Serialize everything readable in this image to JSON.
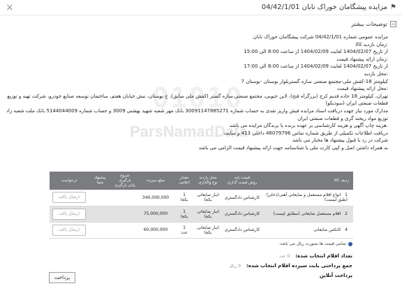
{
  "header": {
    "title": "مزایده پیشگامان خوراک تابان 04/42/1/01"
  },
  "section": {
    "title": "توضیحات بیشتر"
  },
  "description": [
    "مزایده عمومی شماره 04/42/1/01 شرکت پیشگامان خوراک تابان",
    ":زمان بازدید کالا",
    "از تاریخ 1404/02/07 لغایت 1404/02/09 از ساعت 8:00 الی 15:00",
    ":زمان ارائه پیشنهاد قیمت",
    "از تاریخ 1404/02/07 لغایت 1404/02/09 از ساعت 8:00 الی 17:00",
    ":محل بازدید",
    "کیلومتر 18-کفش ملی-مجتمع صنعتی سازه گستربلوار بوستان -بوستان 7",
    ":محل ارائه پیشنهاد قیمت",
    "تهران، کیلومتر 18 جاده قدیم کرج (بزرگراه فتح)، لاین جنوبی، مجتمع صنعتی سازه گستر (کفش ملی سابق)، خ بوستان، نبش خیابان هفتم، ساختمان توسعه صنایع خودرو، شرکت تهیه و توزیع مواد ریخته گری و",
    "قطعات صنعتی ایران (سودیکو)",
    "مدارک مورد نیاز جهت دریافت اسناد مزایده فیش واریز نقدی به حساب شماره 30091147885271 بانک مهر شعبه شهید بهشتی 3009 و حساب شماره 5144044009 بانک ملت شعبه زامیاد به نام شرکت تهیه و",
    "توزیع مواد ریخته گری و قطعات صنعتی ایران",
    ".هزینه چاپ آگهی و هزینه کارشناسی بر عهده برنده یا برندگان مزایده می باشد",
    "دریافت اطلاعات تکمیلی از طریق شماره تماس 46079796 داخلی 413 و سایت",
    "شرکت در رد یا قبول پیشنهاد ها مختار می باشد",
    "به همراه داشتن اصل و کپی کارت ملی یا شناسنامه جهت ارائه پیشنهاد قیمت الزامی می باشد"
  ],
  "watermark": {
    "number": "01010",
    "name": "ParsNamadData"
  },
  "table": {
    "headers": {
      "row": "ردیف کالا",
      "base_price": "قیمت پایه",
      "pricing_method": "روش قیمت گذاری",
      "location": "محل بازدید",
      "delivery": "نوع واگذاری",
      "quantity": "مقدار اعلامی",
      "amount": "مبلغ سپرده",
      "start_time": "شروع بارگیری",
      "end_time": "پایان بارگیری",
      "user_offer": "پیشنهاد شما",
      "request": "درخواست"
    },
    "rows": [
      {
        "num": "1",
        "name": "انواع اقلام مستعمل و ضایعاتی آهنی(ذخایر)(طبق لیست)",
        "method": "کارشناس دادگستری",
        "location": "انبار ضایعاتی",
        "delivery": "یکجا",
        "qty": "1",
        "qty_unit": "یکجا",
        "amount": "340,000,000",
        "request_label": "ارسال پاکت"
      },
      {
        "num": "2",
        "name": "اقلام مستعمل ضایعاتی (مطابق لیست)",
        "method": "کارشناس دادگستری",
        "location": "انبار ضایعاتی",
        "delivery": "یکجا",
        "qty": "1",
        "qty_unit": "یکجا",
        "amount": "75,000,000",
        "request_label": "ارسال پاکت"
      },
      {
        "num": "4",
        "name": "کانکس ضایعاتی",
        "method": "کارشناس دادگستری",
        "location": "انبار ضایعاتی",
        "delivery": "یکجا",
        "qty": "1",
        "qty_unit": "عدد",
        "amount": "60,000,000",
        "request_label": "ارسال پاکت"
      }
    ]
  },
  "note": "تمامی قیمت ها بصورت ریال می باشد.",
  "summary": {
    "selected_count_label": "تعداد اقلام انتخاب شده:",
    "selected_count_value": "0 عدد",
    "deposit_total_label": "جمع پرداختی بابت سپرده اقلام انتخاب شده:",
    "deposit_total_value": "0 ریال",
    "online_payment_label": "پرداخت آنلاین"
  },
  "pay_button_label": "پرداخت"
}
